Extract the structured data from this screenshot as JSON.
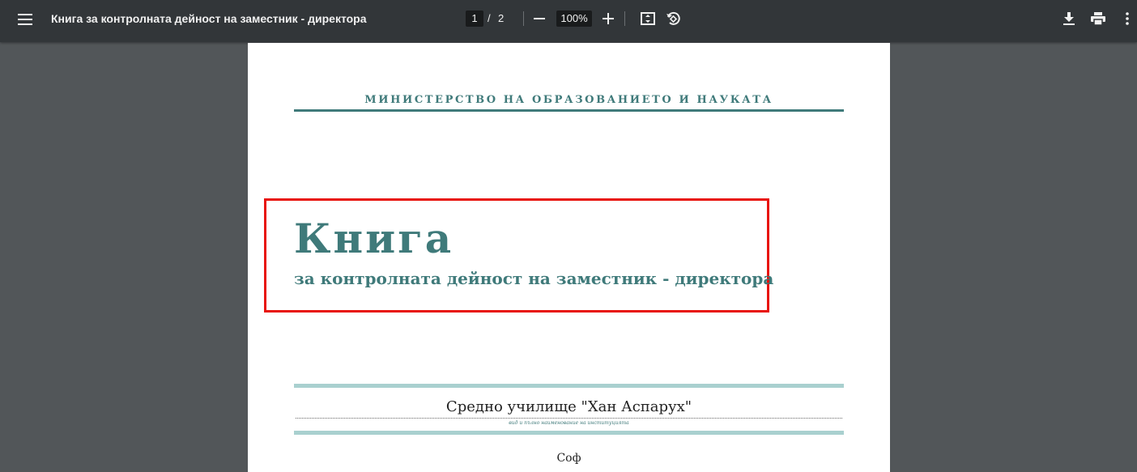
{
  "toolbar": {
    "title": "Книга за контролната дейност на заместник - директора",
    "page_current": "1",
    "page_separator": "/",
    "page_total": "2",
    "zoom": "100%",
    "icons": [
      "menu-icon",
      "zoom-out-icon",
      "zoom-in-icon",
      "fit-page-icon",
      "rotate-icon",
      "download-icon",
      "print-icon",
      "more-icon"
    ]
  },
  "document": {
    "ministry": "МИНИСТЕРСТВО НА ОБРАЗОВАНИЕТО И НАУКАТА",
    "title": "Книга",
    "subtitle": "за контролната дейност на заместник - директора",
    "school": "Средно училище \"Хан Аспарух\"",
    "caption": "вид и пълно наименование на институцията",
    "cut_text": "Соф",
    "colors": {
      "accent": "#3f7a7a",
      "band": "#a9d0cf",
      "highlight": "#e8120c"
    }
  }
}
